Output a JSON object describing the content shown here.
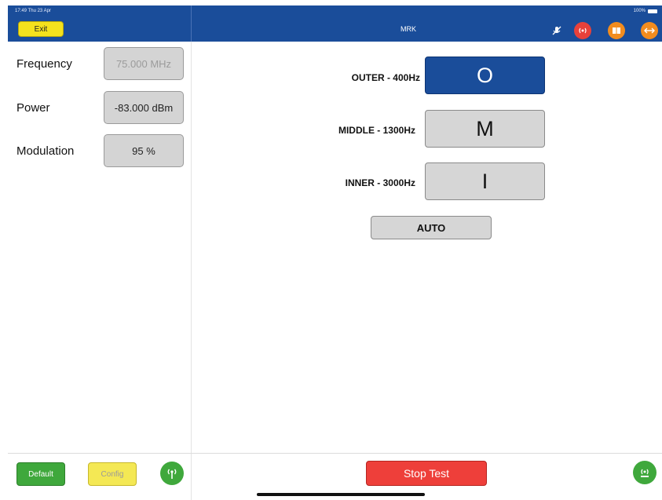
{
  "status": {
    "time": "17:49  Thu 23 Apr",
    "battery": "100%"
  },
  "header": {
    "exit_label": "Exit",
    "title": "MRK",
    "icons": [
      "microphone-off-icon",
      "broadcast-icon",
      "book-icon",
      "arrows-horizontal-icon"
    ],
    "colors": {
      "bar": "#1a4d9a",
      "exit": "#f4e21d",
      "broadcast": "#e8413b",
      "book": "#f28c1e",
      "arrows": "#f28c1e"
    }
  },
  "settings": [
    {
      "label": "Frequency",
      "value": "75.000 MHz",
      "disabled": true
    },
    {
      "label": "Power",
      "value": "-83.000 dBm",
      "disabled": false
    },
    {
      "label": "Modulation",
      "value": "95 %",
      "disabled": false
    }
  ],
  "markers": [
    {
      "label": "OUTER - 400Hz",
      "button": "O",
      "active": true
    },
    {
      "label": "MIDDLE - 1300Hz",
      "button": "M",
      "active": false
    },
    {
      "label": "INNER - 3000Hz",
      "button": "I",
      "active": false
    }
  ],
  "auto_label": "AUTO",
  "footer": {
    "default_label": "Default",
    "config_label": "Config",
    "stop_label": "Stop Test",
    "colors": {
      "default": "#3fa83c",
      "config": "#f4e854",
      "stop": "#ee3f3a"
    }
  }
}
